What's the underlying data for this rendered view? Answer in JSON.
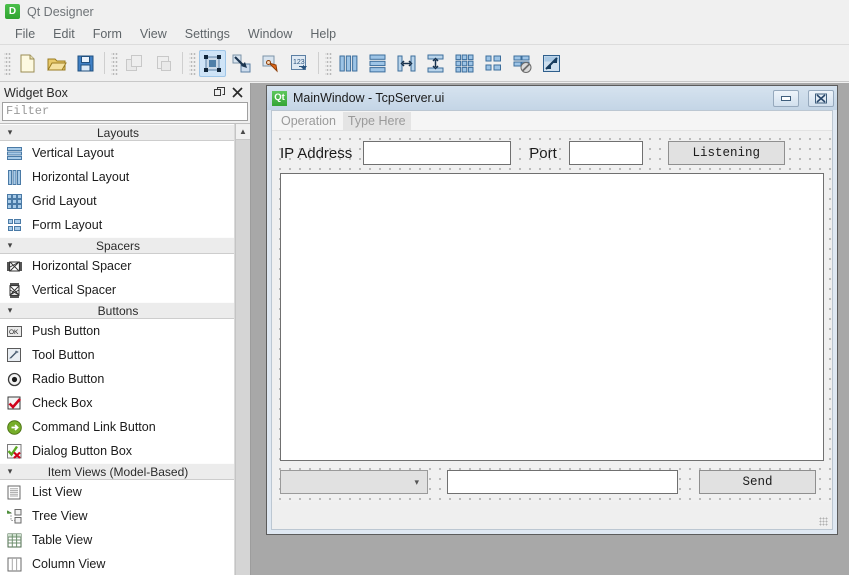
{
  "app": {
    "logo_letter": "D",
    "logo_icon": "designer-app-icon",
    "title": "Qt Designer"
  },
  "menubar": {
    "items": [
      {
        "label": "File"
      },
      {
        "label": "Edit"
      },
      {
        "label": "Form"
      },
      {
        "label": "View"
      },
      {
        "label": "Settings"
      },
      {
        "label": "Window"
      },
      {
        "label": "Help"
      }
    ]
  },
  "toolbar": {
    "groups": [
      {
        "name": "file-group",
        "buttons": [
          {
            "name": "new-form-button",
            "icon": "new-document-icon",
            "selected": false,
            "disabled": false
          },
          {
            "name": "open-form-button",
            "icon": "open-folder-icon",
            "selected": false,
            "disabled": false
          },
          {
            "name": "save-form-button",
            "icon": "save-floppy-icon",
            "selected": false,
            "disabled": false
          }
        ]
      },
      {
        "name": "clipboard-group",
        "buttons": [
          {
            "name": "copy-button",
            "icon": "copy-icon",
            "selected": false,
            "disabled": true
          },
          {
            "name": "paste-button",
            "icon": "paste-icon",
            "selected": false,
            "disabled": true
          }
        ]
      },
      {
        "name": "mode-group",
        "buttons": [
          {
            "name": "edit-widgets-button",
            "icon": "edit-widgets-icon",
            "selected": true,
            "disabled": false
          },
          {
            "name": "edit-signals-slots-button",
            "icon": "signals-slots-icon",
            "selected": false,
            "disabled": false
          },
          {
            "name": "edit-buddies-button",
            "icon": "edit-buddies-icon",
            "selected": false,
            "disabled": false
          },
          {
            "name": "edit-tab-order-button",
            "icon": "tab-order-icon",
            "selected": false,
            "disabled": false
          }
        ]
      },
      {
        "name": "layout-group",
        "buttons": [
          {
            "name": "lay-out-horizontally-button",
            "icon": "layout-horizontal-icon",
            "selected": false,
            "disabled": false
          },
          {
            "name": "lay-out-vertically-button",
            "icon": "layout-vertical-icon",
            "selected": false,
            "disabled": false
          },
          {
            "name": "lay-out-splitter-h-button",
            "icon": "splitter-horizontal-icon",
            "selected": false,
            "disabled": false
          },
          {
            "name": "lay-out-splitter-v-button",
            "icon": "splitter-vertical-icon",
            "selected": false,
            "disabled": false
          },
          {
            "name": "lay-out-grid-button",
            "icon": "layout-grid-icon",
            "selected": false,
            "disabled": false
          },
          {
            "name": "lay-out-form-button",
            "icon": "layout-form-icon",
            "selected": false,
            "disabled": false
          },
          {
            "name": "break-layout-button",
            "icon": "break-layout-icon",
            "selected": false,
            "disabled": false
          },
          {
            "name": "adjust-size-button",
            "icon": "adjust-size-icon",
            "selected": false,
            "disabled": false
          }
        ]
      }
    ]
  },
  "widget_box": {
    "title": "Widget Box",
    "undock_icon": "undock-icon",
    "close_icon": "close-icon",
    "filter": {
      "value": "",
      "placeholder": "Filter"
    },
    "scroll_up_icon": "chevron-up-icon",
    "categories": [
      {
        "label": "Layouts",
        "expanded": true,
        "items": [
          {
            "label": "Vertical Layout",
            "icon": "vertical-layout-icon"
          },
          {
            "label": "Horizontal Layout",
            "icon": "horizontal-layout-icon"
          },
          {
            "label": "Grid Layout",
            "icon": "grid-layout-icon"
          },
          {
            "label": "Form Layout",
            "icon": "form-layout-icon"
          }
        ]
      },
      {
        "label": "Spacers",
        "expanded": true,
        "items": [
          {
            "label": "Horizontal Spacer",
            "icon": "horizontal-spacer-icon"
          },
          {
            "label": "Vertical Spacer",
            "icon": "vertical-spacer-icon"
          }
        ]
      },
      {
        "label": "Buttons",
        "expanded": true,
        "items": [
          {
            "label": "Push Button",
            "icon": "push-button-icon"
          },
          {
            "label": "Tool Button",
            "icon": "tool-button-icon"
          },
          {
            "label": "Radio Button",
            "icon": "radio-button-icon"
          },
          {
            "label": "Check Box",
            "icon": "check-box-icon"
          },
          {
            "label": "Command Link Button",
            "icon": "command-link-icon"
          },
          {
            "label": "Dialog Button Box",
            "icon": "dialog-button-box-icon"
          }
        ]
      },
      {
        "label": "Item Views (Model-Based)",
        "expanded": true,
        "items": [
          {
            "label": "List View",
            "icon": "list-view-icon"
          },
          {
            "label": "Tree View",
            "icon": "tree-view-icon"
          },
          {
            "label": "Table View",
            "icon": "table-view-icon"
          },
          {
            "label": "Column View",
            "icon": "column-view-icon"
          }
        ]
      }
    ]
  },
  "form_window": {
    "logo_letter": "Qt",
    "logo_icon": "qt-logo-icon",
    "title": "MainWindow - TcpServer.ui",
    "minimize_icon": "minimize-icon",
    "close_icon": "close-icon",
    "menubar": [
      {
        "label": "Operation",
        "kind": "menu"
      },
      {
        "label": "Type Here",
        "kind": "placeholder"
      }
    ],
    "top_row": {
      "ip_label": "IP Address",
      "ip_value": "",
      "port_label": "Port",
      "port_value": "",
      "listen_button": "Listening"
    },
    "text_browser": {
      "value": ""
    },
    "bottom_row": {
      "combo_value": "",
      "combo_arrow_icon": "chevron-down-icon",
      "message_value": "",
      "send_button": "Send"
    },
    "size_grip_icon": "resize-grip-icon"
  },
  "colors": {
    "accent_selected": "#cfe4f7",
    "mdi_background": "#a8a8a8",
    "form_titlebar": "#c4d5e6",
    "qt_green": "#34a534",
    "panel": "#f0f0f0"
  }
}
